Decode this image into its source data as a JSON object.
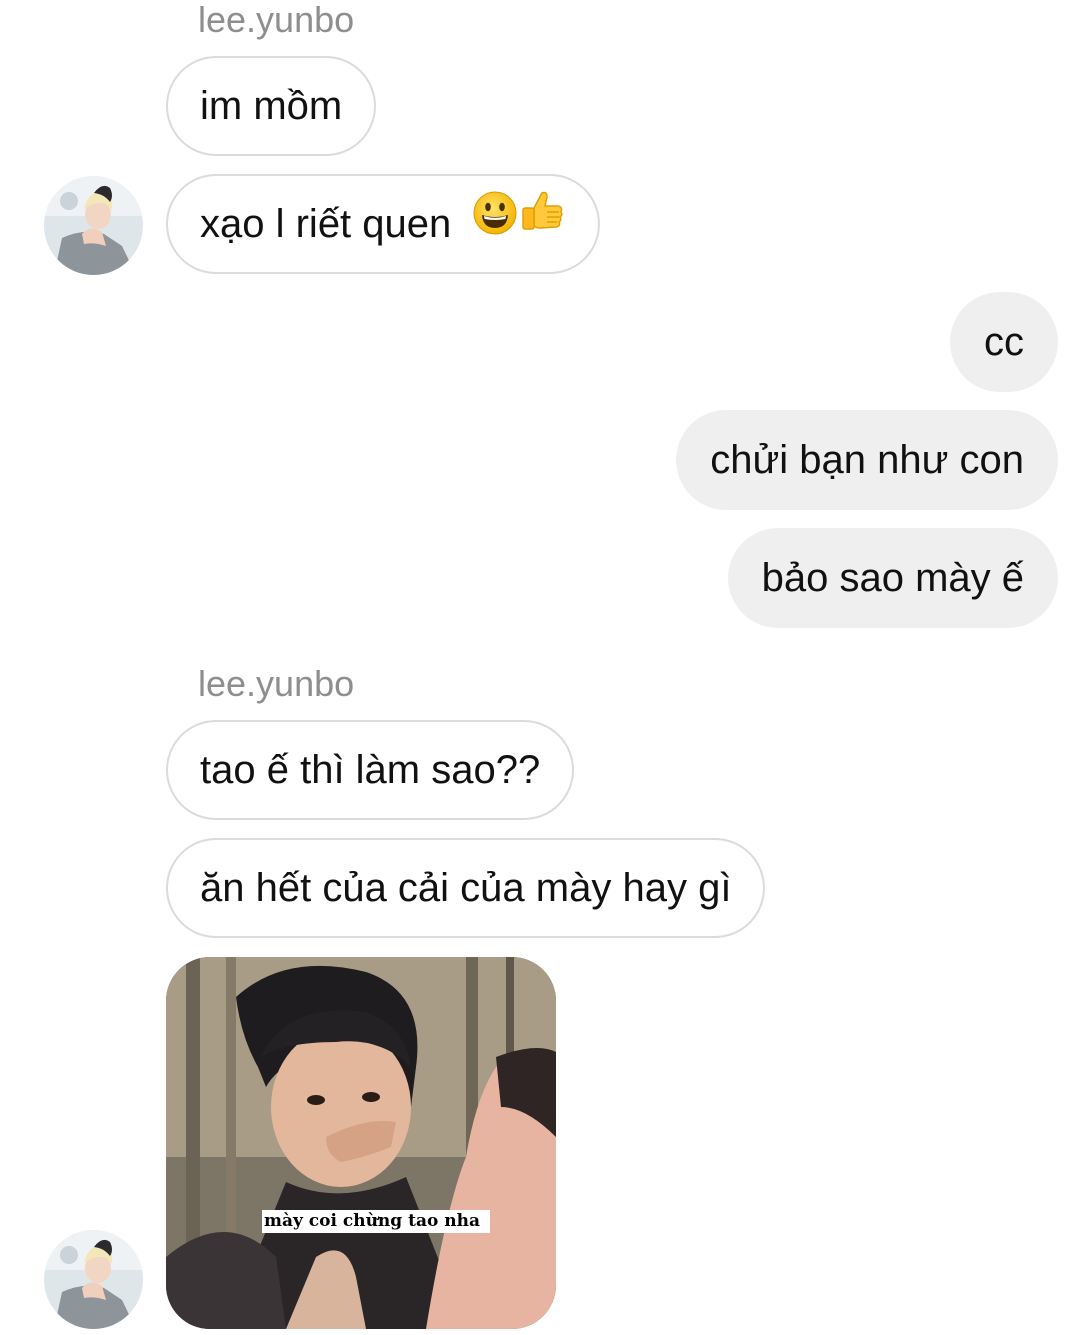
{
  "thread": {
    "messages": [
      {
        "kind": "sender",
        "text": "lee.yunbo"
      },
      {
        "kind": "incoming",
        "text": "im mồm"
      },
      {
        "kind": "incoming",
        "text": "xạo l riết quen",
        "emojis": [
          "grinning-face",
          "thumbs-up"
        ]
      },
      {
        "kind": "outgoing",
        "text": "cc"
      },
      {
        "kind": "outgoing",
        "text": "chửi bạn như con"
      },
      {
        "kind": "outgoing",
        "text": "bảo sao mày ế"
      },
      {
        "kind": "sender",
        "text": "lee.yunbo"
      },
      {
        "kind": "incoming",
        "text": "tao ế thì làm sao??"
      },
      {
        "kind": "incoming",
        "text": "ăn hết của cải của mày hay gì"
      },
      {
        "kind": "image",
        "caption": "mày coi chừng tao nha"
      }
    ]
  },
  "colors": {
    "incoming_border": "#dbdbdb",
    "outgoing_bg": "#efefef",
    "sender_name": "#8e8e8e"
  }
}
